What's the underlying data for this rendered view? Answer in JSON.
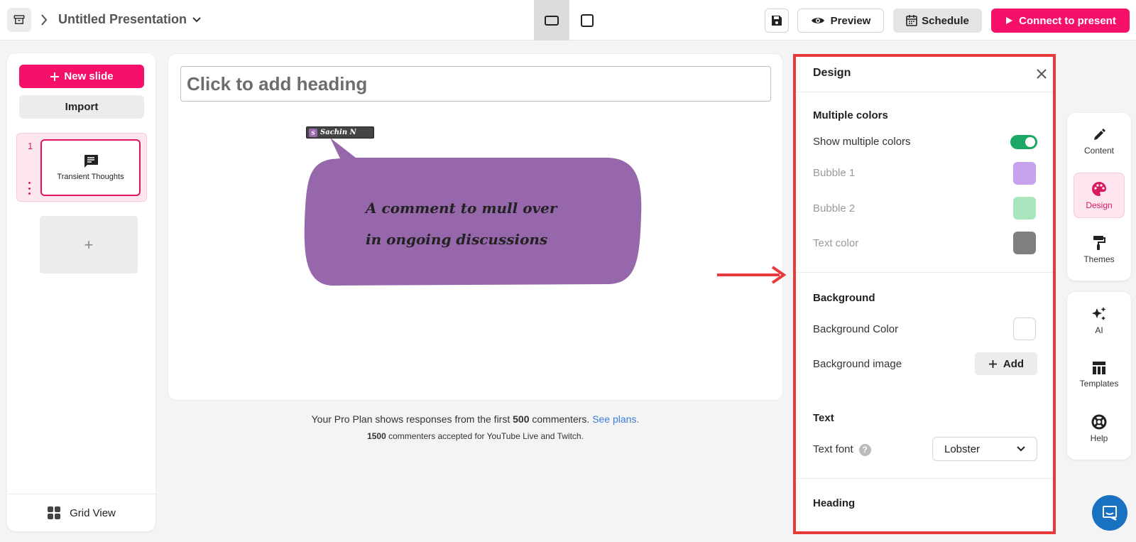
{
  "header": {
    "title": "Untitled Presentation",
    "preview_label": "Preview",
    "schedule_label": "Schedule",
    "connect_label": "Connect to present"
  },
  "sidebar": {
    "new_slide_label": "New slide",
    "import_label": "Import",
    "slides": [
      {
        "number": "1",
        "label": "Transient Thoughts"
      }
    ],
    "add_symbol": "+",
    "grid_view_label": "Grid View"
  },
  "canvas": {
    "heading_placeholder": "Click to add heading",
    "user_tag": {
      "initial": "S",
      "name": "Sachin N"
    },
    "bubble_lines": [
      "A comment to mull over",
      "in ongoing discussions"
    ],
    "plan_note": {
      "prefix": "Your Pro Plan shows responses from the first ",
      "count": "500",
      "suffix": " commenters. ",
      "link": "See plans."
    },
    "plan_note_2": {
      "count": "1500",
      "suffix": " commenters accepted for YouTube Live and Twitch."
    }
  },
  "design_panel": {
    "title": "Design",
    "multiple_colors": {
      "title": "Multiple colors",
      "show_label": "Show multiple colors",
      "show_enabled": true,
      "bubble1_label": "Bubble 1",
      "bubble1_color": "#c7a3ee",
      "bubble2_label": "Bubble 2",
      "bubble2_color": "#a9e6bd",
      "text_color_label": "Text color",
      "text_color": "#7f7f7f"
    },
    "background": {
      "title": "Background",
      "color_label": "Background Color",
      "color": "#ffffff",
      "image_label": "Background image",
      "add_label": "Add"
    },
    "text": {
      "title": "Text",
      "font_label": "Text font",
      "help_symbol": "?",
      "font_value": "Lobster"
    },
    "heading": {
      "title": "Heading"
    }
  },
  "right_rail": {
    "top": [
      {
        "label": "Content",
        "icon": "pencil-icon"
      },
      {
        "label": "Design",
        "icon": "palette-icon"
      },
      {
        "label": "Themes",
        "icon": "paint-roller-icon"
      }
    ],
    "bottom": [
      {
        "label": "AI",
        "icon": "sparkle-icon"
      },
      {
        "label": "Templates",
        "icon": "table-icon"
      },
      {
        "label": "Help",
        "icon": "lifebuoy-icon"
      }
    ]
  },
  "colors": {
    "brand": "#f5106a",
    "bubble_fill": "#9668ab",
    "toggle_on": "#1ba866",
    "highlight_border": "#e83a3a"
  }
}
